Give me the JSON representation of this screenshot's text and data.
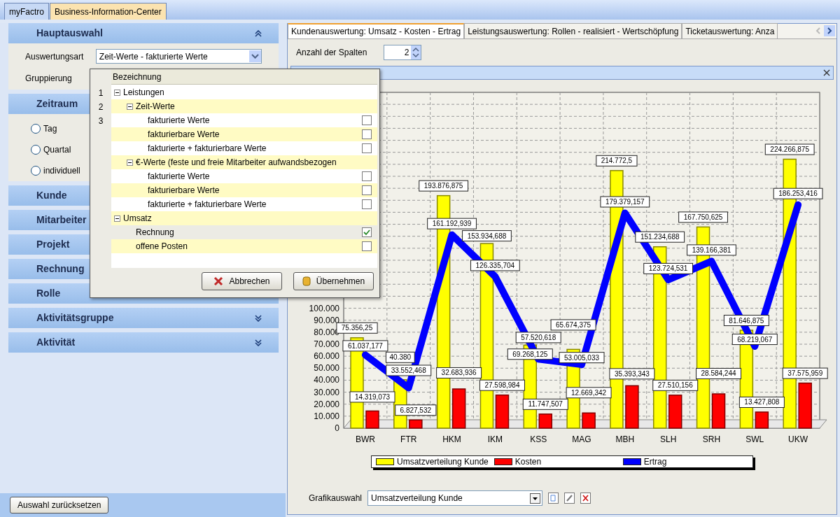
{
  "app_tabs": [
    {
      "label": "myFactro",
      "selected": false
    },
    {
      "label": "Business-Information-Center",
      "selected": true
    }
  ],
  "sidebar": {
    "sections": [
      {
        "title": "Hauptauswahl",
        "expanded": true,
        "kind": "fields",
        "fields": [
          {
            "label": "Auswertungsart",
            "value": "Zeit-Werte - fakturierte Werte"
          },
          {
            "label": "Gruppierung"
          }
        ]
      },
      {
        "title": "Zeitraum",
        "expanded": true,
        "kind": "radios",
        "options": [
          {
            "label": "Tag",
            "selected": false
          },
          {
            "label": "Quartal",
            "selected": false
          },
          {
            "label": "individuell",
            "selected": false
          }
        ]
      },
      {
        "title": "Kunde",
        "expanded": false
      },
      {
        "title": "Mitarbeiter",
        "expanded": false
      },
      {
        "title": "Projekt",
        "expanded": false
      },
      {
        "title": "Rechnung",
        "expanded": false
      },
      {
        "title": "Rolle",
        "expanded": false
      },
      {
        "title": "Aktivitätsgruppe",
        "expanded": false
      },
      {
        "title": "Aktivität",
        "expanded": false
      }
    ],
    "reset_button": "Auswahl zurücksetzen"
  },
  "dropdown": {
    "header": "Bezeichnung",
    "row_numbers": [
      "1",
      "2",
      "3"
    ],
    "tree": [
      {
        "label": "Leistungen",
        "expanded": true,
        "children": [
          {
            "label": "Zeit-Werte",
            "expanded": true,
            "children": [
              {
                "label": "fakturierte Werte",
                "checked": false,
                "selected": false
              },
              {
                "label": "fakturierbare Werte",
                "checked": false,
                "selected": false
              },
              {
                "label": "fakturierte + fakturierbare Werte",
                "checked": false,
                "selected": false
              }
            ]
          },
          {
            "label": "€-Werte (feste und freie Mitarbeiter aufwandsbezogen",
            "expanded": true,
            "children": [
              {
                "label": "fakturierte Werte",
                "checked": false,
                "selected": false
              },
              {
                "label": "fakturierbare Werte",
                "checked": false,
                "selected": false
              },
              {
                "label": "fakturierte + fakturierbare Werte",
                "checked": false,
                "selected": false
              }
            ]
          }
        ]
      },
      {
        "label": "Umsatz",
        "expanded": true,
        "children": [
          {
            "label": "Rechnung",
            "checked": true,
            "selected": true
          },
          {
            "label": "offene Posten",
            "checked": false,
            "selected": false
          }
        ]
      }
    ],
    "buttons": [
      {
        "label": "Abbrechen",
        "kind": "cancel"
      },
      {
        "label": "Übernehmen",
        "kind": "apply"
      }
    ]
  },
  "report_tabs": [
    {
      "label": "Kundenauswertung: Umsatz - Kosten - Ertrag",
      "selected": true
    },
    {
      "label": "Leistungsauswertung: Rollen - realisiert - Wertschöpfung",
      "selected": false
    },
    {
      "label": "Ticketauswertung: Anza",
      "selected": false
    }
  ],
  "columns": {
    "label": "Anzahl der Spalten",
    "value": "2"
  },
  "chart_data": {
    "type": "bar",
    "categories": [
      "BWR",
      "FTR",
      "HKM",
      "IKM",
      "KSS",
      "MAG",
      "MBH",
      "SLH",
      "SRH",
      "SWL",
      "UKW"
    ],
    "series": [
      {
        "name": "Umsatzverteilung Kunde",
        "color": "#ffff00",
        "values": [
          75356.25,
          40380,
          193876.875,
          153934.688,
          69268.125,
          65674.375,
          214772.5,
          151234.688,
          167750.625,
          81646.875,
          224266.875
        ],
        "value_labels": [
          "75.356,25",
          "40.380",
          "193.876,875",
          "153.934,688",
          "69.268,125",
          "65.674,375",
          "214.772,5",
          "151.234,688",
          "167.750,625",
          "81.646,875",
          "224.266,875"
        ]
      },
      {
        "name": "Kosten",
        "color": "#ff0000",
        "values": [
          14319.073,
          6827.532,
          32683.936,
          27598.984,
          11747.507,
          12669.342,
          35393.343,
          27510.156,
          28584.244,
          13427.808,
          37575.959
        ],
        "value_labels": [
          "14.319,073",
          "6.827,532",
          "32.683,936",
          "27.598,984",
          "11.747,507",
          "12.669,342",
          "35.393,343",
          "27.510,156",
          "28.584,244",
          "13.427,808",
          "37.575,959"
        ]
      },
      {
        "name": "Ertrag",
        "color": "#0000ff",
        "type": "line",
        "values": [
          61037.177,
          33552.468,
          161192.939,
          126335.704,
          57520.618,
          53005.033,
          179379.157,
          123724.531,
          139166.381,
          68219.067,
          186253.416
        ],
        "value_labels": [
          "61.037,177",
          "33.552,468",
          "161.192,939",
          "126.335,704",
          "57.520,618",
          "53.005,033",
          "179.379,157",
          "123.724,531",
          "139.166,381",
          "68.219,067",
          "186.253,416"
        ]
      }
    ],
    "ylim": [
      0,
      280000
    ],
    "yticks": [
      {
        "value": 0,
        "label": "0"
      },
      {
        "value": 10000,
        "label": "10.000"
      },
      {
        "value": 20000,
        "label": "20.000"
      },
      {
        "value": 30000,
        "label": "30.000"
      },
      {
        "value": 40000,
        "label": "40.000"
      },
      {
        "value": 50000,
        "label": "50.000"
      },
      {
        "value": 60000,
        "label": "60.000"
      },
      {
        "value": 70000,
        "label": "70.000"
      },
      {
        "value": 80000,
        "label": "80.000"
      },
      {
        "value": 90000,
        "label": "90.000"
      },
      {
        "value": 100000,
        "label": "100.000"
      }
    ],
    "stacked": false,
    "grid": true,
    "data_labels": true
  },
  "chart_select": {
    "label": "Grafikauswahl",
    "value": "Umsatzverteilung Kunde"
  }
}
